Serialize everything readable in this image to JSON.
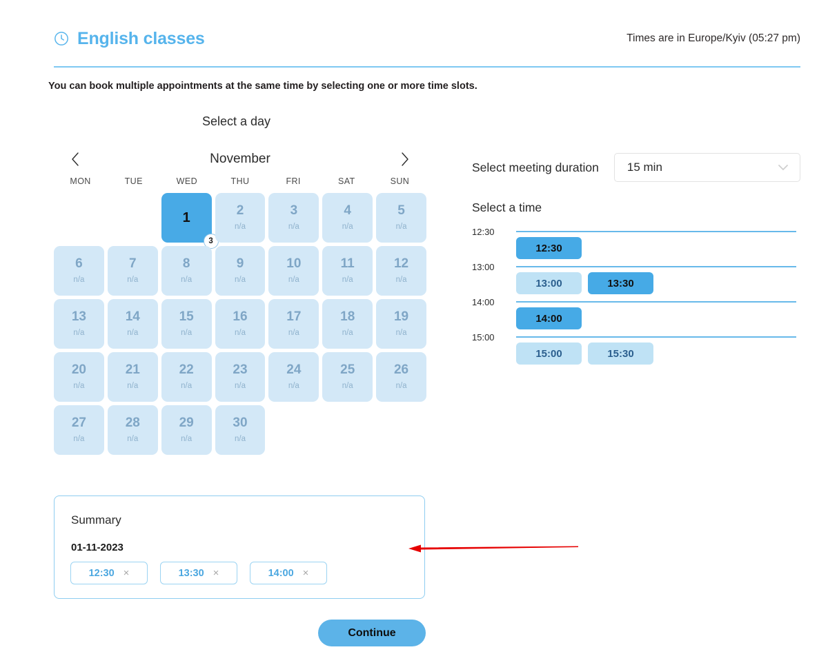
{
  "header": {
    "title": "English classes",
    "clock_icon": "clock-icon",
    "timezone_note": "Times are in Europe/Kyiv (05:27 pm)"
  },
  "intro": {
    "text": "You can book multiple appointments at the same time by selecting one or more time slots."
  },
  "calendar": {
    "section_label": "Select a day",
    "month": "November",
    "prev_label": "‹",
    "next_label": "›",
    "weekdays": [
      "MON",
      "TUE",
      "WED",
      "THU",
      "FRI",
      "SAT",
      "SUN"
    ],
    "lead_blanks": 2,
    "unavailable_text": "n/a",
    "selected_day": 1,
    "selected_badge": "3",
    "days": [
      {
        "num": "1",
        "status": "selected"
      },
      {
        "num": "2",
        "status": "na"
      },
      {
        "num": "3",
        "status": "na"
      },
      {
        "num": "4",
        "status": "na"
      },
      {
        "num": "5",
        "status": "na"
      },
      {
        "num": "6",
        "status": "na"
      },
      {
        "num": "7",
        "status": "na"
      },
      {
        "num": "8",
        "status": "na"
      },
      {
        "num": "9",
        "status": "na"
      },
      {
        "num": "10",
        "status": "na"
      },
      {
        "num": "11",
        "status": "na"
      },
      {
        "num": "12",
        "status": "na"
      },
      {
        "num": "13",
        "status": "na"
      },
      {
        "num": "14",
        "status": "na"
      },
      {
        "num": "15",
        "status": "na"
      },
      {
        "num": "16",
        "status": "na"
      },
      {
        "num": "17",
        "status": "na"
      },
      {
        "num": "18",
        "status": "na"
      },
      {
        "num": "19",
        "status": "na"
      },
      {
        "num": "20",
        "status": "na"
      },
      {
        "num": "21",
        "status": "na"
      },
      {
        "num": "22",
        "status": "na"
      },
      {
        "num": "23",
        "status": "na"
      },
      {
        "num": "24",
        "status": "na"
      },
      {
        "num": "25",
        "status": "na"
      },
      {
        "num": "26",
        "status": "na"
      },
      {
        "num": "27",
        "status": "na"
      },
      {
        "num": "28",
        "status": "na"
      },
      {
        "num": "29",
        "status": "na"
      },
      {
        "num": "30",
        "status": "na"
      }
    ]
  },
  "duration": {
    "label": "Select meeting duration",
    "value": "15 min",
    "chevron_icon": "chevron-down-icon"
  },
  "time_picker": {
    "label": "Select a time",
    "rows": [
      {
        "hour": "12:30",
        "slots": [
          {
            "time": "12:30",
            "state": "selected"
          }
        ]
      },
      {
        "hour": "13:00",
        "slots": [
          {
            "time": "13:00",
            "state": "free"
          },
          {
            "time": "13:30",
            "state": "selected"
          }
        ]
      },
      {
        "hour": "14:00",
        "slots": [
          {
            "time": "14:00",
            "state": "selected"
          }
        ]
      },
      {
        "hour": "15:00",
        "slots": [
          {
            "time": "15:00",
            "state": "free"
          },
          {
            "time": "15:30",
            "state": "free"
          }
        ]
      }
    ]
  },
  "summary": {
    "title": "Summary",
    "date": "01-11-2023",
    "chips": [
      {
        "time": "12:30",
        "remove_icon": "close-icon"
      },
      {
        "time": "13:30",
        "remove_icon": "close-icon"
      },
      {
        "time": "14:00",
        "remove_icon": "close-icon"
      }
    ]
  },
  "footer": {
    "continue_label": "Continue"
  },
  "annotation": {
    "arrow_icon": "red-arrow-left-icon",
    "color": "#e60000"
  },
  "colors": {
    "accent": "#56b4ec",
    "slot_selected": "#46aae6",
    "slot_free": "#bfe2f5",
    "day_cell": "#d3e8f7",
    "divider": "#7ec8f2"
  }
}
